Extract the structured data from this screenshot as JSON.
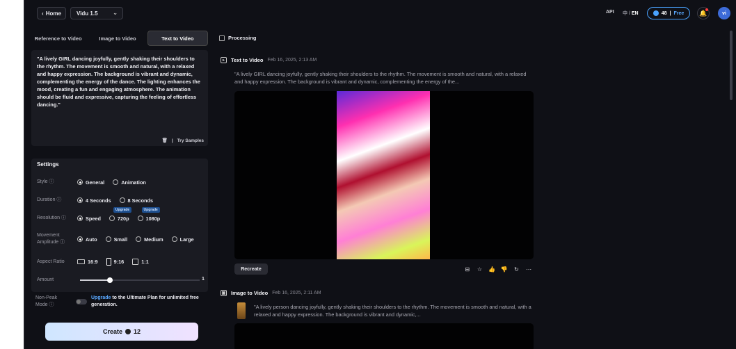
{
  "topbar": {
    "home_label": "Home",
    "model": "Vidu 1.5",
    "api": "API",
    "lang_cn": "中",
    "lang_sep": "/",
    "lang_en": "EN",
    "credits": "48",
    "credits_plan": "Free",
    "avatar": "vi"
  },
  "tabs": [
    {
      "label": "Reference to Video"
    },
    {
      "label": "Image to Video"
    },
    {
      "label": "Text to Video"
    }
  ],
  "prompt": {
    "text": "\"A lively GIRL dancing joyfully, gently shaking their shoulders to the rhythm. The movement is smooth and natural, with a relaxed and happy expression. The background is vibrant and dynamic, complementing the energy of the dance. The lighting enhances the mood, creating a fun and engaging atmosphere. The animation should be fluid and expressive, capturing the feeling of effortless dancing.\"",
    "try_samples": "Try Samples"
  },
  "settings": {
    "title": "Settings",
    "style": {
      "label": "Style",
      "options": [
        "General",
        "Animation"
      ],
      "selected": "General"
    },
    "duration": {
      "label": "Duration",
      "options": [
        "4 Seconds",
        "8 Seconds"
      ],
      "selected": "4 Seconds"
    },
    "resolution": {
      "label": "Resolution",
      "options": [
        "Speed",
        "720p",
        "1080p"
      ],
      "selected": "Speed",
      "badge": "Upgrade"
    },
    "movement": {
      "label_1": "Movement",
      "label_2": "Amplitude",
      "options": [
        "Auto",
        "Small",
        "Medium",
        "Large"
      ],
      "selected": "Auto"
    },
    "aspect": {
      "label": "Aspect Ratio",
      "options": [
        "16:9",
        "9:16",
        "1:1"
      ],
      "selected": "9:16"
    },
    "amount": {
      "label": "Amount",
      "value": "1",
      "fraction": 0.25
    }
  },
  "nonpeak": {
    "label_1": "Non-Peak",
    "label_2": "Mode",
    "link": "Upgrade",
    "message": " to the Ultimate Plan for unlimited free generation."
  },
  "create": {
    "label": "Create",
    "cost": "12"
  },
  "right": {
    "processing": "Processing",
    "items": [
      {
        "type": "Text to Video",
        "date": "Feb 16, 2025, 2:13 AM",
        "desc": "\"A lively GIRL dancing joyfully, gently shaking their shoulders to the rhythm. The movement is smooth and natural, with a relaxed and happy expression. The background is vibrant and dynamic, complementing the energy of the..."
      },
      {
        "type": "Image to Video",
        "date": "Feb 16, 2025, 2:11 AM",
        "desc": "\"A lively person dancing joyfully, gently shaking their shoulders to the rhythm. The movement is smooth and natural, with a relaxed and happy expression. The background is vibrant and dynamic,..."
      }
    ],
    "recreate": "Recreate"
  }
}
